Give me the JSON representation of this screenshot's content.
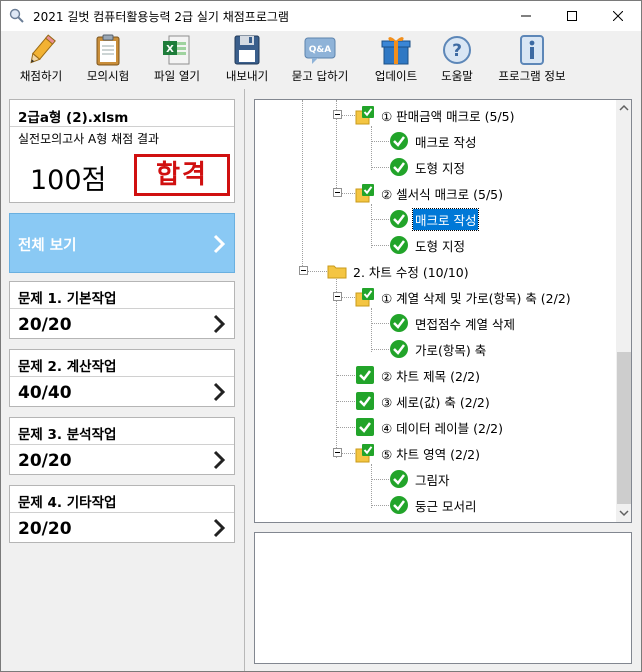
{
  "window": {
    "title": "2021 길벗 컴퓨터활용능력 2급 실기 채점프로그램"
  },
  "toolbar": {
    "items": [
      {
        "label": "채점하기",
        "icon": "pencil-icon"
      },
      {
        "label": "모의시험",
        "icon": "clipboard-icon"
      },
      {
        "label": "파일 열기",
        "icon": "excel-file-icon"
      },
      {
        "label": "내보내기",
        "icon": "floppy-disk-icon"
      },
      {
        "label": "묻고 답하기",
        "icon": "qa-icon"
      },
      {
        "label": "업데이트",
        "icon": "gift-icon"
      },
      {
        "label": "도움말",
        "icon": "help-icon"
      },
      {
        "label": "프로그램 정보",
        "icon": "info-icon"
      }
    ]
  },
  "result": {
    "file": "2급a형 (2).xlsm",
    "subtitle": "실전모의고사 A형 채점 결과",
    "score": "100점",
    "stamp": "합격"
  },
  "all_view": {
    "label": "전체 보기"
  },
  "problems": [
    {
      "title": "문제 1. 기본작업",
      "score": "20/20"
    },
    {
      "title": "문제 2. 계산작업",
      "score": "40/40"
    },
    {
      "title": "문제 3. 분석작업",
      "score": "20/20"
    },
    {
      "title": "문제 4. 기타작업",
      "score": "20/20"
    }
  ],
  "tree": {
    "nodes": [
      {
        "label": "① 판매금액 매크로 (5/5)",
        "type": "folder-check"
      },
      {
        "label": "매크로 작성",
        "type": "check"
      },
      {
        "label": "도형 지정",
        "type": "check"
      },
      {
        "label": "② 셀서식 매크로 (5/5)",
        "type": "folder-check"
      },
      {
        "label": "매크로 작성",
        "type": "check",
        "selected": true
      },
      {
        "label": "도형 지정",
        "type": "check"
      },
      {
        "label": "2. 차트 수정 (10/10)",
        "type": "folder"
      },
      {
        "label": "① 계열 삭제 및 가로(항목) 축 (2/2)",
        "type": "folder-check"
      },
      {
        "label": "면접점수 계열 삭제",
        "type": "check"
      },
      {
        "label": "가로(항목) 축",
        "type": "check"
      },
      {
        "label": "② 차트 제목 (2/2)",
        "type": "checkbox"
      },
      {
        "label": "③ 세로(값) 축 (2/2)",
        "type": "checkbox"
      },
      {
        "label": "④ 데이터 레이블 (2/2)",
        "type": "checkbox"
      },
      {
        "label": "⑤ 차트 영역 (2/2)",
        "type": "folder-check"
      },
      {
        "label": "그림자",
        "type": "check"
      },
      {
        "label": "둥근 모서리",
        "type": "check"
      }
    ]
  },
  "colors": {
    "accent": "#8ac9f4",
    "selection": "#0078d7",
    "stamp": "#d01010",
    "check_green": "#22a42a"
  }
}
